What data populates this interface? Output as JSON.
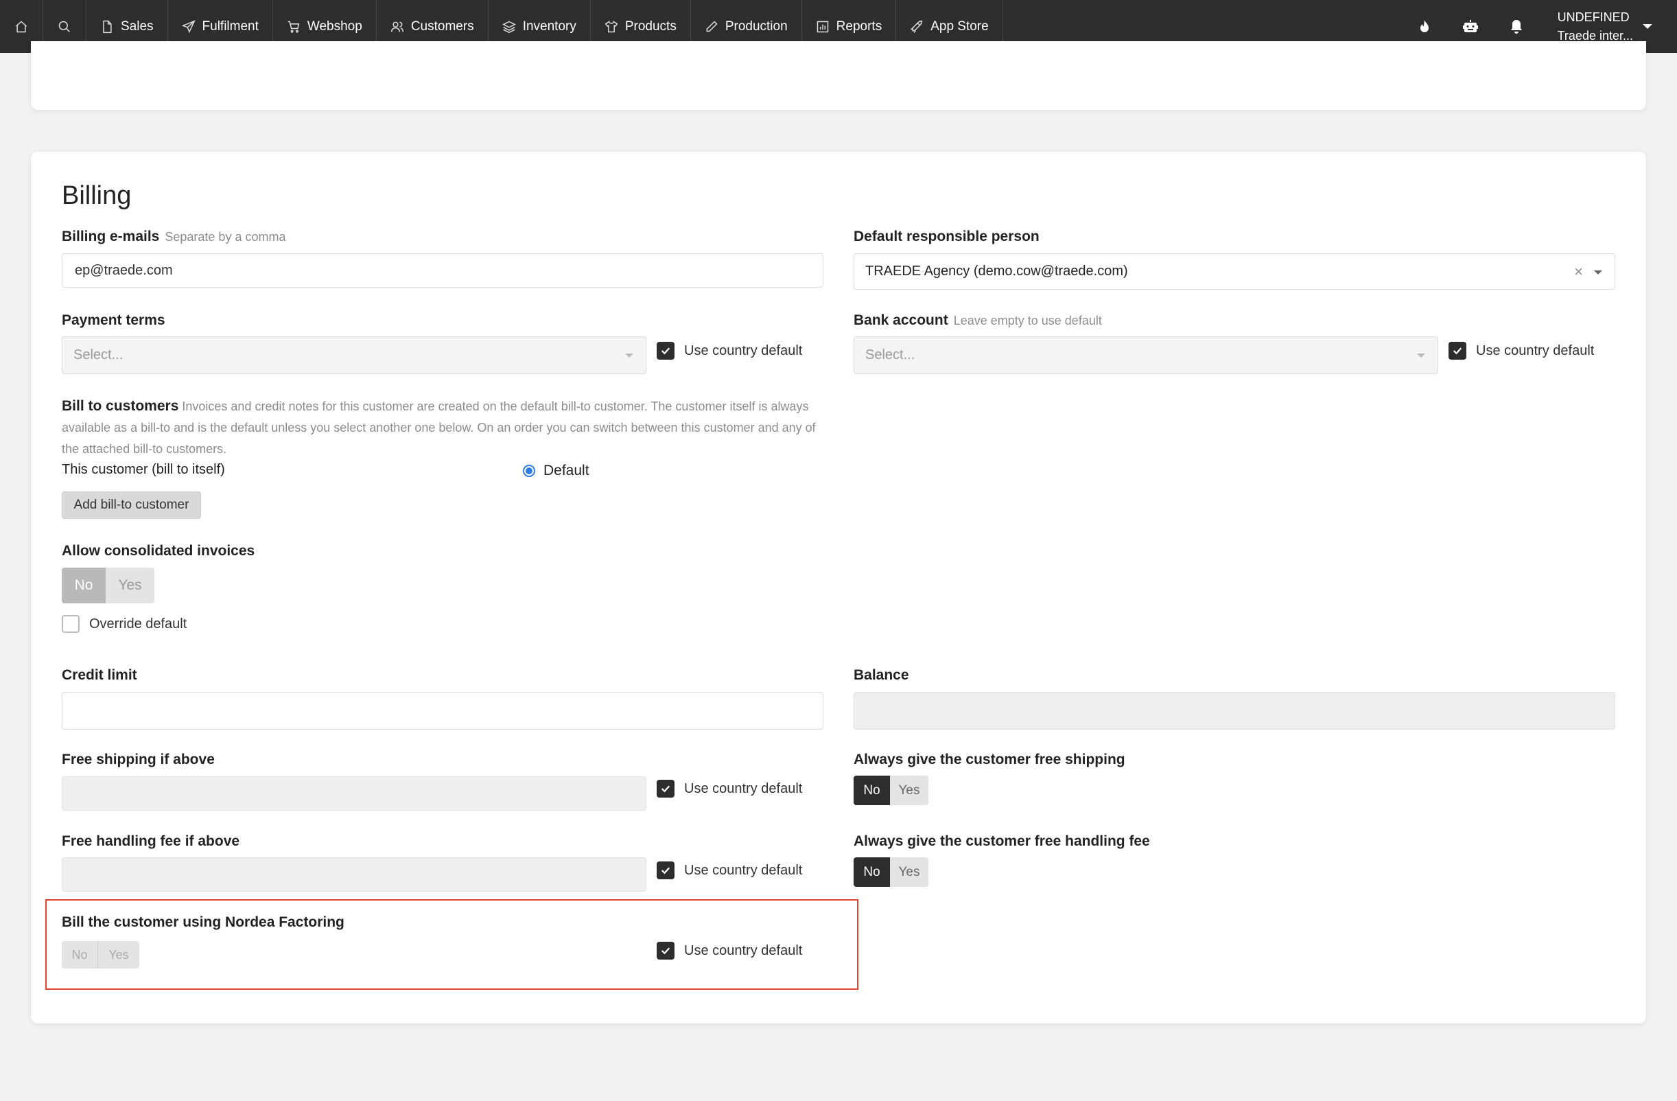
{
  "nav": {
    "items": [
      {
        "label": "Sales",
        "icon": "document-icon"
      },
      {
        "label": "Fulfilment",
        "icon": "send-icon"
      },
      {
        "label": "Webshop",
        "icon": "cart-icon"
      },
      {
        "label": "Customers",
        "icon": "users-icon"
      },
      {
        "label": "Inventory",
        "icon": "layers-icon"
      },
      {
        "label": "Products",
        "icon": "shirt-icon"
      },
      {
        "label": "Production",
        "icon": "pencil-icon"
      },
      {
        "label": "Reports",
        "icon": "bar-chart-icon"
      },
      {
        "label": "App Store",
        "icon": "rocket-icon"
      }
    ],
    "user_line1": "UNDEFINED",
    "user_line2": "Traede inter..."
  },
  "billing": {
    "title": "Billing",
    "billing_emails": {
      "label": "Billing e-mails",
      "hint": "Separate by a comma",
      "value": "ep@traede.com"
    },
    "responsible": {
      "label": "Default responsible person",
      "value": "TRAEDE Agency (demo.cow@traede.com)"
    },
    "payment_terms": {
      "label": "Payment terms",
      "placeholder": "Select...",
      "checkbox": "Use country default"
    },
    "bank_account": {
      "label": "Bank account",
      "hint": "Leave empty to use default",
      "placeholder": "Select...",
      "checkbox": "Use country default"
    },
    "bill_to": {
      "label": "Bill to customers",
      "hint": "Invoices and credit notes for this customer are created on the default bill-to customer. The customer itself is always available as a bill-to and is the default unless you select another one below. On an order you can switch between this customer and any of the attached bill-to customers.",
      "self_label": "This customer (bill to itself)",
      "default_radio": "Default",
      "add_button": "Add bill-to customer"
    },
    "consolidated": {
      "label": "Allow consolidated invoices",
      "no": "No",
      "yes": "Yes",
      "override": "Override default"
    },
    "credit_limit": {
      "label": "Credit limit",
      "value": ""
    },
    "balance": {
      "label": "Balance",
      "value": ""
    },
    "free_shipping": {
      "label": "Free shipping if above",
      "checkbox": "Use country default"
    },
    "always_free_shipping": {
      "label": "Always give the customer free shipping",
      "no": "No",
      "yes": "Yes"
    },
    "free_handling": {
      "label": "Free handling fee if above",
      "checkbox": "Use country default"
    },
    "always_free_handling": {
      "label": "Always give the customer free handling fee",
      "no": "No",
      "yes": "Yes"
    },
    "nordea": {
      "label": "Bill the customer using Nordea Factoring",
      "no": "No",
      "yes": "Yes",
      "checkbox": "Use country default"
    }
  }
}
